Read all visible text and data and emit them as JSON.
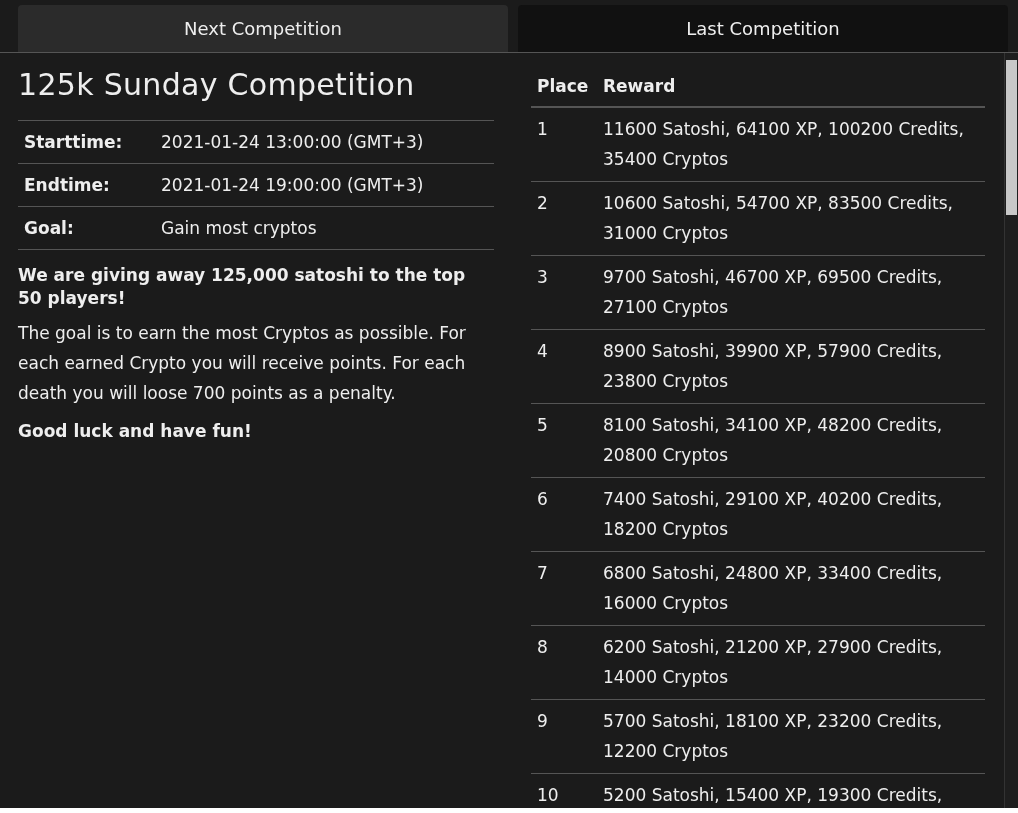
{
  "tabs": [
    {
      "label": "Next Competition",
      "selected": true
    },
    {
      "label": "Last Competition",
      "selected": false
    }
  ],
  "competition": {
    "title": "125k Sunday Competition",
    "details": [
      {
        "label": "Starttime:",
        "value": "2021-01-24 13:00:00 (GMT+3)"
      },
      {
        "label": "Endtime:",
        "value": "2021-01-24 19:00:00 (GMT+3)"
      },
      {
        "label": "Goal:",
        "value": "Gain most cryptos"
      }
    ],
    "headline": "We are giving away 125,000 satoshi to the top 50 players!",
    "description": "The goal is to earn the most Cryptos as possible. For each earned Crypto you will receive points. For each death you will loose 700 points as a penalty.",
    "closing": "Good luck and have fun!"
  },
  "rewards": {
    "columns": [
      "Place",
      "Reward"
    ],
    "rows": [
      {
        "place": "1",
        "reward": "11600 Satoshi, 64100 XP, 100200 Credits, 35400 Cryptos"
      },
      {
        "place": "2",
        "reward": "10600 Satoshi, 54700 XP, 83500 Credits, 31000 Cryptos"
      },
      {
        "place": "3",
        "reward": "9700 Satoshi, 46700 XP, 69500 Credits, 27100 Cryptos"
      },
      {
        "place": "4",
        "reward": "8900 Satoshi, 39900 XP, 57900 Credits, 23800 Cryptos"
      },
      {
        "place": "5",
        "reward": "8100 Satoshi, 34100 XP, 48200 Credits, 20800 Cryptos"
      },
      {
        "place": "6",
        "reward": "7400 Satoshi, 29100 XP, 40200 Credits, 18200 Cryptos"
      },
      {
        "place": "7",
        "reward": "6800 Satoshi, 24800 XP, 33400 Credits, 16000 Cryptos"
      },
      {
        "place": "8",
        "reward": "6200 Satoshi, 21200 XP, 27900 Credits, 14000 Cryptos"
      },
      {
        "place": "9",
        "reward": "5700 Satoshi, 18100 XP, 23200 Credits, 12200 Cryptos"
      },
      {
        "place": "10",
        "reward": "5200 Satoshi, 15400 XP, 19300 Credits,"
      }
    ]
  }
}
